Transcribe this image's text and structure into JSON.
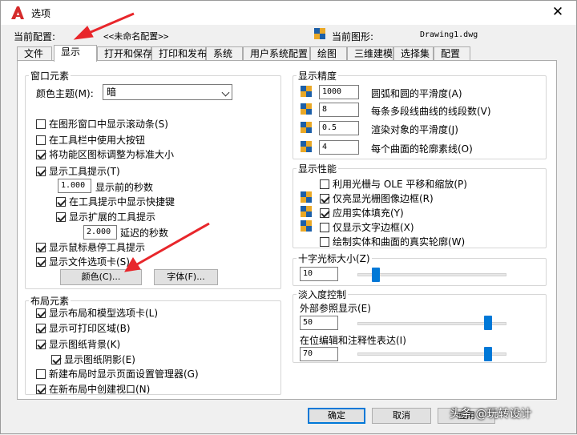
{
  "window": {
    "title": "选项"
  },
  "header": {
    "profile_label": "当前配置:",
    "profile_value": "<<未命名配置>>",
    "drawing_label": "当前图形:",
    "drawing_value": "Drawing1.dwg"
  },
  "tabs": [
    "文件",
    "显示",
    "打开和保存",
    "打印和发布",
    "系统",
    "用户系统配置",
    "绘图",
    "三维建模",
    "选择集",
    "配置"
  ],
  "window_elements": {
    "legend": "窗口元素",
    "color_theme_label": "颜色主题(M):",
    "color_theme_value": "暗",
    "cb_scrollbars": "在图形窗口中显示滚动条(S)",
    "cb_large_buttons": "在工具栏中使用大按钮",
    "cb_ribbon_icons": "将功能区图标调整为标准大小",
    "cb_tooltips": "显示工具提示(T)",
    "tooltip_delay_value": "1.000",
    "tooltip_delay_label": "显示前的秒数",
    "cb_shortcut_keys": "在工具提示中显示快捷键",
    "cb_extended_tooltips": "显示扩展的工具提示",
    "extended_delay_value": "2.000",
    "extended_delay_label": "延迟的秒数",
    "cb_rollover": "显示鼠标悬停工具提示",
    "cb_file_tabs": "显示文件选项卡(S)",
    "colors_button": "颜色(C)...",
    "fonts_button": "字体(F)..."
  },
  "layout_elements": {
    "legend": "布局元素",
    "cb_layout_tabs": "显示布局和模型选项卡(L)",
    "cb_printable_area": "显示可打印区域(B)",
    "cb_paper_background": "显示图纸背景(K)",
    "cb_paper_shadow": "显示图纸阴影(E)",
    "cb_page_setup": "新建布局时显示页面设置管理器(G)",
    "cb_create_viewport": "在新布局中创建视口(N)"
  },
  "display_resolution": {
    "legend": "显示精度",
    "arc_value": "1000",
    "arc_label": "圆弧和圆的平滑度(A)",
    "polyline_value": "8",
    "polyline_label": "每条多段线曲线的线段数(V)",
    "render_value": "0.5",
    "render_label": "渲染对象的平滑度(J)",
    "contour_value": "4",
    "contour_label": "每个曲面的轮廓素线(O)"
  },
  "display_performance": {
    "legend": "显示性能",
    "cb_raster_ole": "利用光栅与 OLE 平移和缩放(P)",
    "cb_raster_frame": "仅亮显光栅图像边框(R)",
    "cb_solid_fill": "应用实体填充(Y)",
    "cb_text_frame": "仅显示文字边框(X)",
    "cb_silhouettes": "绘制实体和曲面的真实轮廓(W)"
  },
  "crosshair": {
    "legend": "十字光标大小(Z)",
    "value": "10",
    "level_percent": 10
  },
  "fade_control": {
    "legend": "淡入度控制",
    "xref_label": "外部参照显示(E)",
    "xref_value": "50",
    "xref_level_percent": 90,
    "inplace_label": "在位编辑和注释性表达(I)",
    "inplace_value": "70",
    "inplace_level_percent": 90
  },
  "footer": {
    "ok": "确定",
    "cancel": "取消",
    "apply": "应用"
  },
  "watermark": "头条 @玩转设计",
  "colors": {
    "accent": "#0078d7",
    "annotation_red": "#e8262b",
    "logo_red": "#d52b2b"
  }
}
